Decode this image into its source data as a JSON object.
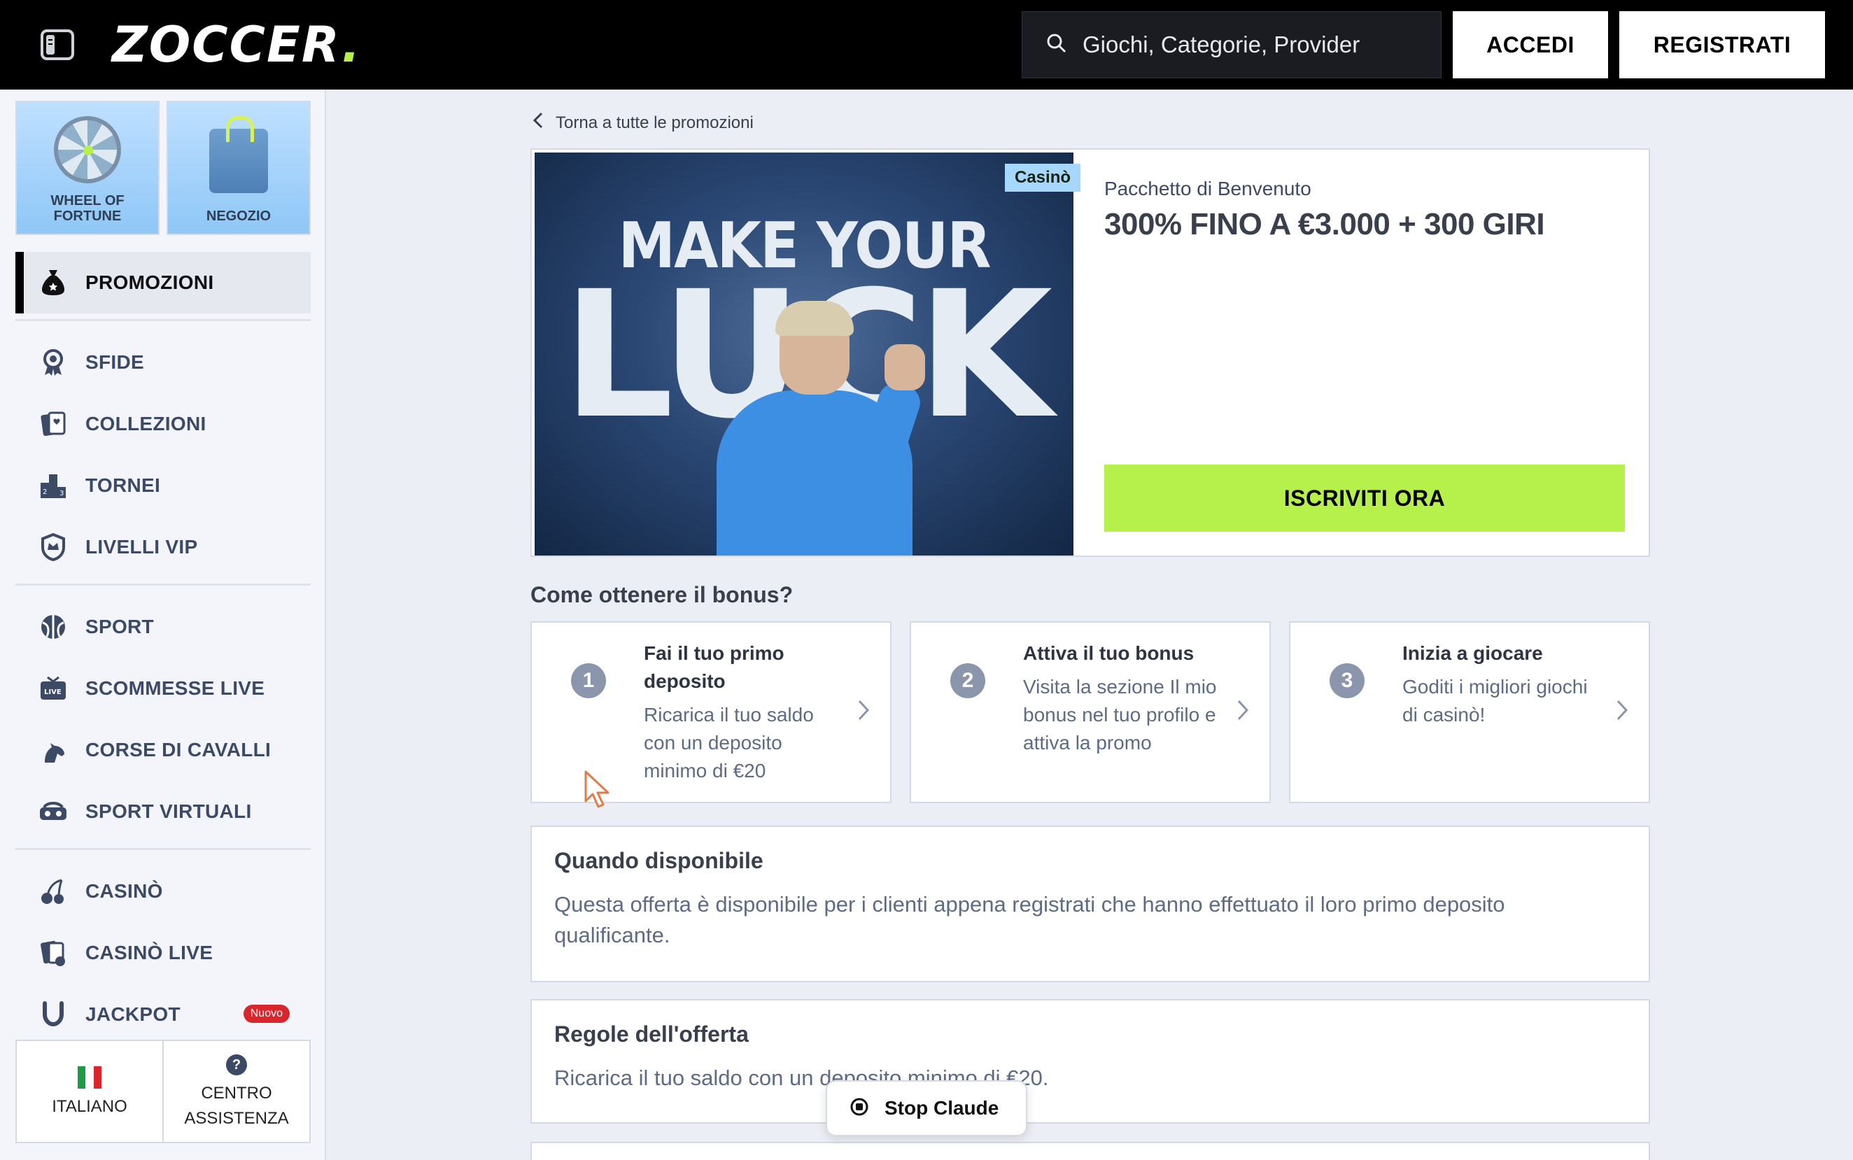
{
  "header": {
    "logo_text": "ZOCCER",
    "logo_dot": ".",
    "search_placeholder": "Giochi, Categorie, Provider",
    "login_label": "ACCEDI",
    "register_label": "REGISTRATI"
  },
  "sidebar": {
    "tiles": [
      {
        "label": "WHEEL OF FORTUNE",
        "icon": "wheel-icon"
      },
      {
        "label": "NEGOZIO",
        "icon": "shop-bag-icon"
      }
    ],
    "active_item": {
      "label": "PROMOZIONI",
      "icon": "money-bag-icon"
    },
    "group1": [
      {
        "label": "SFIDE",
        "icon": "award-icon"
      },
      {
        "label": "COLLEZIONI",
        "icon": "cards-icon"
      },
      {
        "label": "TORNEI",
        "icon": "podium-icon"
      },
      {
        "label": "LIVELLI VIP",
        "icon": "shield-crown-icon"
      }
    ],
    "group2": [
      {
        "label": "SPORT",
        "icon": "ball-icon"
      },
      {
        "label": "SCOMMESSE LIVE",
        "icon": "live-tv-icon"
      },
      {
        "label": "CORSE DI CAVALLI",
        "icon": "horse-icon"
      },
      {
        "label": "SPORT VIRTUALI",
        "icon": "vr-icon"
      }
    ],
    "group3": [
      {
        "label": "CASINÒ",
        "icon": "cherries-icon"
      },
      {
        "label": "CASINÒ LIVE",
        "icon": "live-cards-icon"
      },
      {
        "label": "JACKPOT",
        "icon": "horseshoe-icon",
        "badge": "Nuovo"
      }
    ],
    "footer": {
      "language_label": "ITALIANO",
      "help_label_1": "CENTRO",
      "help_label_2": "ASSISTENZA",
      "help_icon_text": "?"
    }
  },
  "main": {
    "back_label": "Torna a tutte le promozioni",
    "promo": {
      "tag": "Casinò",
      "image_line1": "MAKE YOUR",
      "image_line2": "LUCK",
      "subtitle": "Pacchetto di Benvenuto",
      "title": "300% FINO A €3.000 + 300 GIRI",
      "cta": "ISCRIVITI ORA"
    },
    "how_title": "Come ottenere il bonus?",
    "steps": [
      {
        "num": "1",
        "title": "Fai il tuo primo deposito",
        "desc": "Ricarica il tuo saldo con un deposito minimo di €20"
      },
      {
        "num": "2",
        "title": "Attiva il tuo bonus",
        "desc": "Visita la sezione Il mio bonus nel tuo profilo e attiva la promo"
      },
      {
        "num": "3",
        "title": "Inizia a giocare",
        "desc": "Goditi i migliori giochi di casinò!"
      }
    ],
    "availability": {
      "title": "Quando disponibile",
      "text": "Questa offerta è disponibile per i clienti appena registrati che hanno effettuato il loro primo deposito qualificante."
    },
    "rules": {
      "title": "Regole dell'offerta",
      "text": "Ricarica il tuo saldo con un deposito minimo di €20."
    }
  },
  "overlay": {
    "stop_label": "Stop Claude"
  },
  "colors": {
    "accent": "#b6f04b",
    "header_bg": "#000000",
    "badge_red": "#d9262d",
    "tag_blue": "#a6d8ff"
  }
}
